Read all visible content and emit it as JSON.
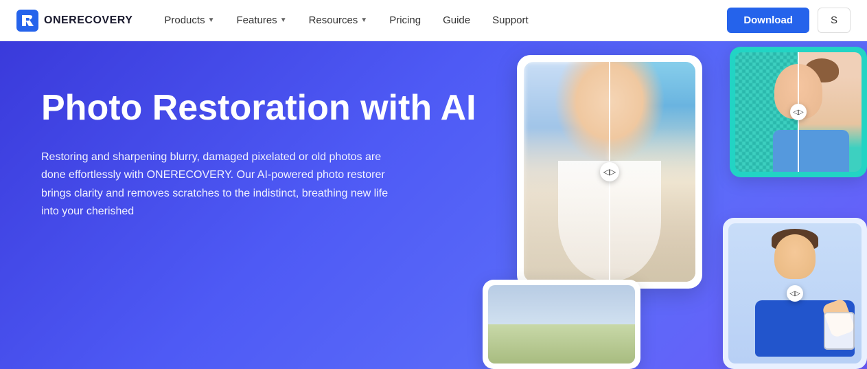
{
  "logo": {
    "text": "ONERECOVERY"
  },
  "navbar": {
    "items": [
      {
        "label": "Products",
        "hasDropdown": true
      },
      {
        "label": "Features",
        "hasDropdown": true
      },
      {
        "label": "Resources",
        "hasDropdown": true
      },
      {
        "label": "Pricing",
        "hasDropdown": false
      },
      {
        "label": "Guide",
        "hasDropdown": false
      },
      {
        "label": "Support",
        "hasDropdown": false
      }
    ],
    "download_label": "Download",
    "signin_label": "S"
  },
  "hero": {
    "title": "Photo Restoration with AI",
    "description": "Restoring and sharpening blurry, damaged pixelated or old photos are done effortlessly with ONERECOVERY. Our AI-powered photo restorer brings clarity and removes scratches to the indistinct, breathing new life into your cherished"
  }
}
